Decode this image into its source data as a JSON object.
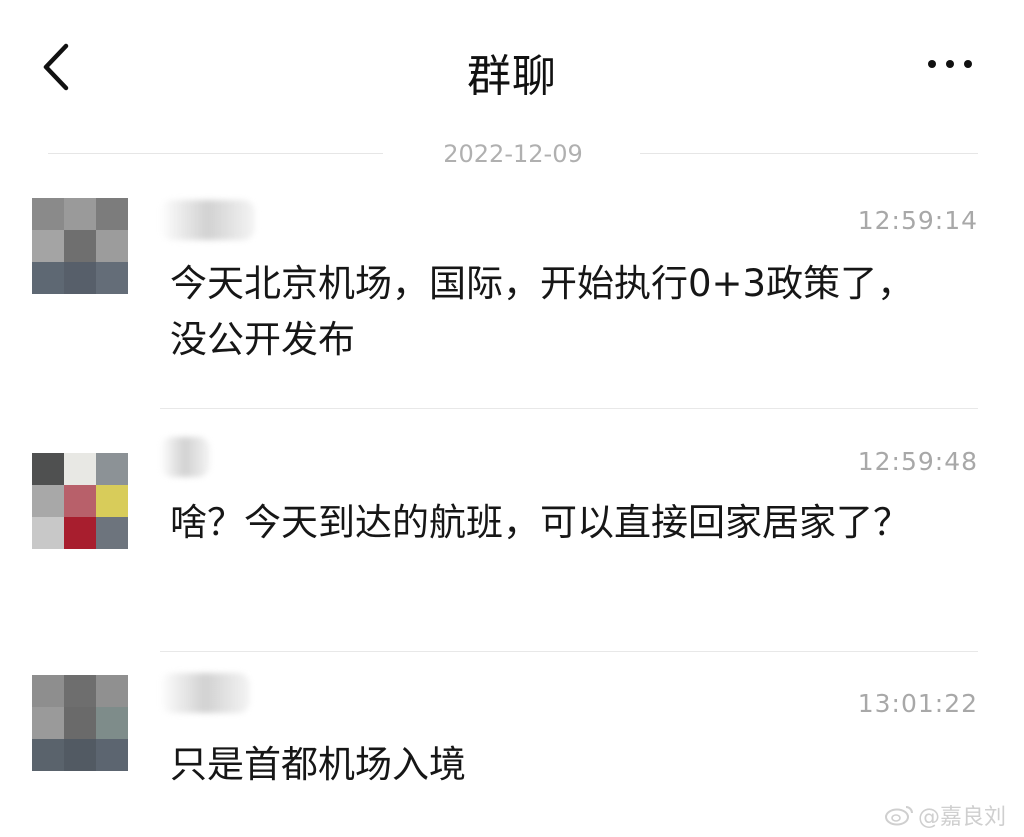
{
  "header": {
    "title": "群聊",
    "back_icon": "chevron-left-icon",
    "more_icon": "more-dots-icon"
  },
  "date_separator": "2022-12-09",
  "messages": [
    {
      "time": "12:59:14",
      "text": "今天北京机场，国际，开始执行0+3政策了，没公开发布",
      "avatar_colors": [
        "#8a8a8a",
        "#9a9a9a",
        "#7c7c7c",
        "#a4a4a4",
        "#6f6f6f",
        "#9c9c9c",
        "#5e6873",
        "#575f6a",
        "#646d78"
      ]
    },
    {
      "time": "12:59:48",
      "text": "啥？今天到达的航班，可以直接回家居家了？",
      "avatar_colors": [
        "#4f5050",
        "#e8e8e4",
        "#8c9296",
        "#a8a8a8",
        "#b8606a",
        "#d8cc5a",
        "#c8c8c8",
        "#a81e2e",
        "#6d747d"
      ]
    },
    {
      "time": "13:01:22",
      "text": "只是首都机场入境",
      "avatar_colors": [
        "#8e8e8e",
        "#6e6e6e",
        "#909090",
        "#9a9a9a",
        "#6a6a6a",
        "#7e8c8a",
        "#5a636c",
        "#525a63",
        "#5c6570"
      ]
    }
  ],
  "watermark": "@嘉良刘"
}
